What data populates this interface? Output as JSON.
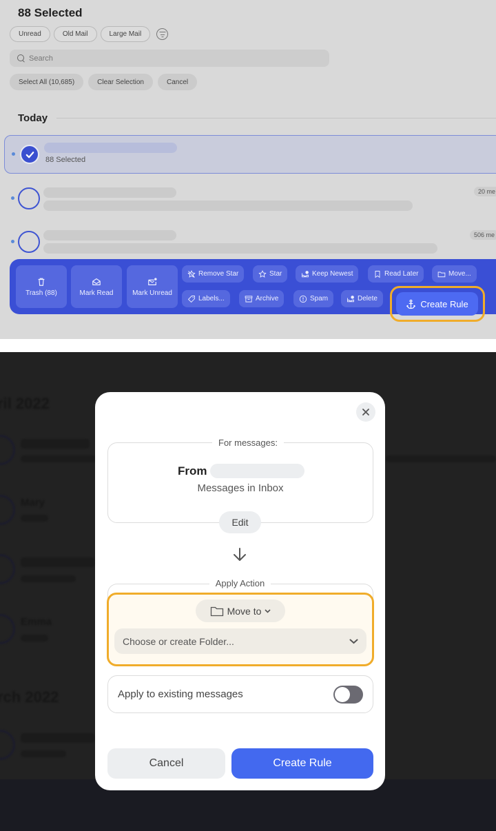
{
  "header": {
    "title": "88 Selected",
    "quick_filters": [
      "Unread",
      "Old Mail",
      "Large Mail"
    ],
    "search_placeholder": "Search",
    "selection_actions": {
      "select_all": "Select All (10,685)",
      "clear_selection": "Clear Selection",
      "cancel": "Cancel"
    }
  },
  "list": {
    "section_label": "Today",
    "rows": [
      {
        "subtitle": "88 Selected",
        "selected": true,
        "count": ""
      },
      {
        "subtitle": "",
        "selected": false,
        "count": "20 me"
      },
      {
        "subtitle": "",
        "selected": false,
        "count": "506 me"
      }
    ]
  },
  "toolbar": {
    "large_buttons": [
      {
        "label": "Trash (88)",
        "icon": "trash-icon"
      },
      {
        "label": "Mark Read",
        "icon": "envelope-open-icon"
      },
      {
        "label": "Mark Unread",
        "icon": "envelope-dot-icon"
      }
    ],
    "row1": [
      {
        "label": "Remove Star",
        "icon": "star-slash-icon"
      },
      {
        "label": "Star",
        "icon": "star-icon"
      },
      {
        "label": "Keep Newest",
        "icon": "tray-badge-icon"
      },
      {
        "label": "Read Later",
        "icon": "bookmark-icon"
      },
      {
        "label": "Move...",
        "icon": "folder-icon"
      }
    ],
    "row2": [
      {
        "label": "Labels...",
        "icon": "tag-icon"
      },
      {
        "label": "Archive",
        "icon": "archive-box-icon"
      },
      {
        "label": "Spam",
        "icon": "exclamation-circle-icon"
      },
      {
        "label": "Delete",
        "icon": "tray-delete-icon"
      }
    ],
    "create_rule": "Create Rule",
    "accent": "#3a4fd5",
    "highlight": "#f0ac2a"
  },
  "background": {
    "headings": [
      "ril 2022",
      "rch 2022"
    ],
    "senders": [
      "Mary",
      "Emma"
    ]
  },
  "modal": {
    "for_messages_label": "For messages:",
    "from_label": "From",
    "scope": "Messages in Inbox",
    "edit": "Edit",
    "apply_action_label": "Apply Action",
    "action_type": "Move to",
    "folder_placeholder": "Choose or create Folder...",
    "apply_existing_label": "Apply to existing messages",
    "apply_existing_enabled": false,
    "cancel": "Cancel",
    "create": "Create Rule",
    "primary_color": "#4369ef"
  }
}
